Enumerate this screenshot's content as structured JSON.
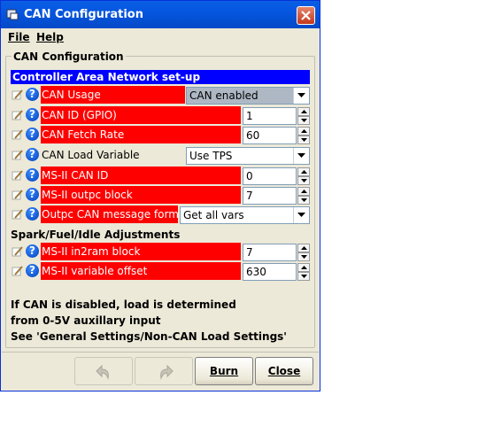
{
  "window": {
    "title": "CAN Configuration"
  },
  "menu": {
    "file": "File",
    "help": "Help"
  },
  "group_title": "CAN Configuration",
  "section_header": "Controller Area Network set-up",
  "rows": [
    {
      "label": "CAN Usage",
      "control": "combo",
      "value": "CAN enabled"
    },
    {
      "label": "CAN ID (GPIO)",
      "control": "spinner",
      "value": "1"
    },
    {
      "label": "CAN Fetch Rate",
      "control": "spinner",
      "value": "60"
    },
    {
      "label": "CAN Load Variable",
      "control": "combo",
      "value": "Use TPS"
    },
    {
      "label": "MS-II CAN ID",
      "control": "spinner",
      "value": "0"
    },
    {
      "label": "MS-II outpc block",
      "control": "spinner",
      "value": "7"
    },
    {
      "label": "Outpc CAN message format",
      "control": "combo",
      "value": "Get all vars"
    }
  ],
  "subsection": "Spark/Fuel/Idle Adjustments",
  "rows2": [
    {
      "label": "MS-II in2ram block",
      "control": "spinner",
      "value": "7"
    },
    {
      "label": "MS-II variable offset",
      "control": "spinner",
      "value": "630"
    }
  ],
  "notes": [
    "If CAN is disabled, load is determined",
    "from 0-5V auxillary input",
    "See 'General Settings/Non-CAN Load Settings'"
  ],
  "buttons": {
    "burn": "Burn",
    "close": "Close"
  },
  "icons": {
    "title": "app-icon",
    "close": "close-icon",
    "pencil": "pencil-icon",
    "help": "help-icon",
    "undo": "undo-icon",
    "redo": "redo-icon"
  },
  "help_glyph": "?",
  "colors": {
    "titlebar": "#0556e0",
    "section_header": "#0000ff",
    "required_label": "#ff0000",
    "window_bg": "#ece9d8"
  }
}
